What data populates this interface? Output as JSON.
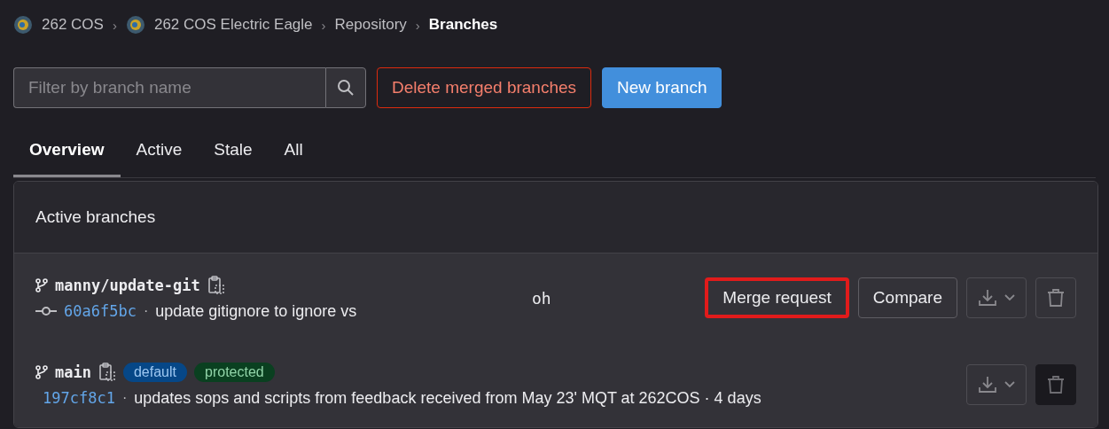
{
  "breadcrumbs": [
    {
      "label": "262 COS",
      "avatar": true,
      "current": false
    },
    {
      "separator": "›",
      "label": "262 COS Electric Eagle",
      "avatar": true,
      "current": false
    },
    {
      "separator": "›",
      "label": "Repository",
      "current": false
    },
    {
      "separator": "›",
      "label": "Branches",
      "current": true
    }
  ],
  "filter": {
    "placeholder": "Filter by branch name"
  },
  "actions": [
    {
      "label": "Delete merged branches",
      "kind": "danger"
    },
    {
      "label": "New branch",
      "kind": "primary"
    }
  ],
  "tabs": [
    {
      "label": "Overview",
      "selected": true
    },
    {
      "label": "Active",
      "selected": false
    },
    {
      "label": "Stale",
      "selected": false
    },
    {
      "label": "All",
      "selected": false
    }
  ],
  "panel": {
    "title": "Active branches",
    "branches": [
      {
        "name": "manny/update-git",
        "sha": "60a6f5bc",
        "separator": "·",
        "message": "update gitignore to ignore vs",
        "stray_text": "oh",
        "buttons": [
          {
            "label": "Merge request",
            "highlighted": true
          },
          {
            "label": "Compare",
            "highlighted": false
          }
        ],
        "delete_disabled": false
      },
      {
        "name": "main",
        "badges": [
          {
            "label": "default",
            "kind": "info"
          },
          {
            "label": "protected",
            "kind": "success"
          }
        ],
        "sha": "197cf8c1",
        "separator": "·",
        "message": "updates sops and scripts from feedback received from May 23' MQT at 262COS · 4 days",
        "delete_disabled": true
      }
    ]
  }
}
